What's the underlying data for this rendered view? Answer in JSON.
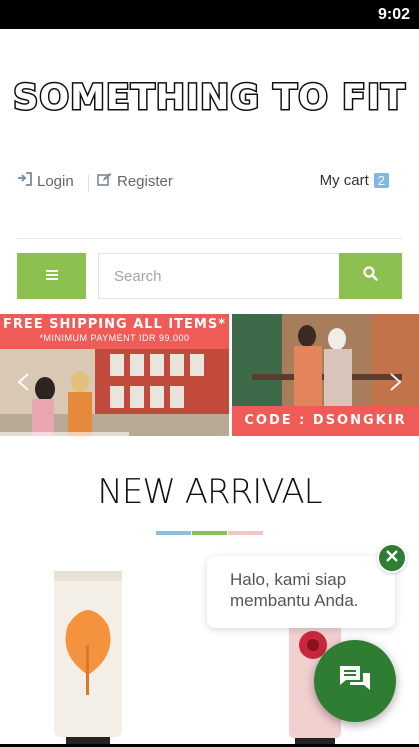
{
  "status": {
    "time": "9:02"
  },
  "brand": {
    "logo_text": "SOMETHING TO FIT"
  },
  "account": {
    "login_label": "Login",
    "register_label": "Register",
    "cart_label": "My cart",
    "cart_count": "2"
  },
  "search": {
    "placeholder": "Search"
  },
  "banner": {
    "promo_title": "FREE SHIPPING ALL ITEMS*",
    "promo_subtitle": "*MINIMUM PAYMENT IDR 99.000",
    "code_text": "CODE : DSONGKIR"
  },
  "section": {
    "title": "NEW ARRIVAL"
  },
  "chat": {
    "message": "Halo, kami siap membantu Anda."
  },
  "colors": {
    "accent_green": "#8cc152",
    "promo_red": "#ef5b57",
    "whatsapp_green": "#2e7d32",
    "accent_blue": "#8cc0e0",
    "accent_pink": "#f0c8c4",
    "cart_badge": "#7fb8e0"
  },
  "icons": {
    "login": "sign-in-icon",
    "register": "edit-icon",
    "menu": "hamburger-icon",
    "search": "search-icon",
    "prev": "chevron-left-icon",
    "next": "chevron-right-icon",
    "close": "close-icon",
    "chat": "chat-icon"
  }
}
